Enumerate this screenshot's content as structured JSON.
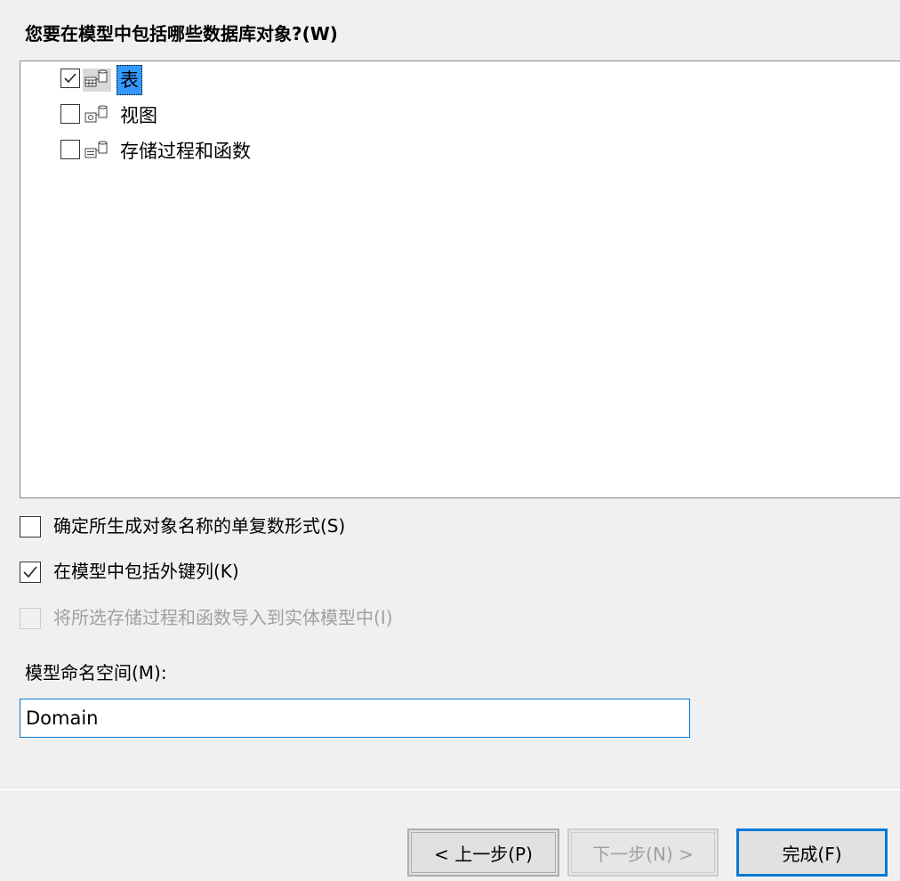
{
  "prompt": "您要在模型中包括哪些数据库对象?(W)",
  "tree": {
    "items": [
      {
        "label": "表",
        "checked": true,
        "icon": "table-db-icon"
      },
      {
        "label": "视图",
        "checked": false,
        "icon": "view-db-icon"
      },
      {
        "label": "存储过程和函数",
        "checked": false,
        "icon": "procedure-db-icon"
      }
    ]
  },
  "options": {
    "pluralize": {
      "label": "确定所生成对象名称的单复数形式(S)",
      "checked": false
    },
    "foreign_keys": {
      "label": "在模型中包括外键列(K)",
      "checked": true
    },
    "import_procs": {
      "label": "将所选存储过程和函数导入到实体模型中(I)",
      "checked": false,
      "disabled": true
    }
  },
  "namespace": {
    "label": "模型命名空间(M):",
    "value": "Domain"
  },
  "buttons": {
    "back": "< 上一步(P)",
    "next": "下一步(N) >",
    "finish": "完成(F)"
  }
}
